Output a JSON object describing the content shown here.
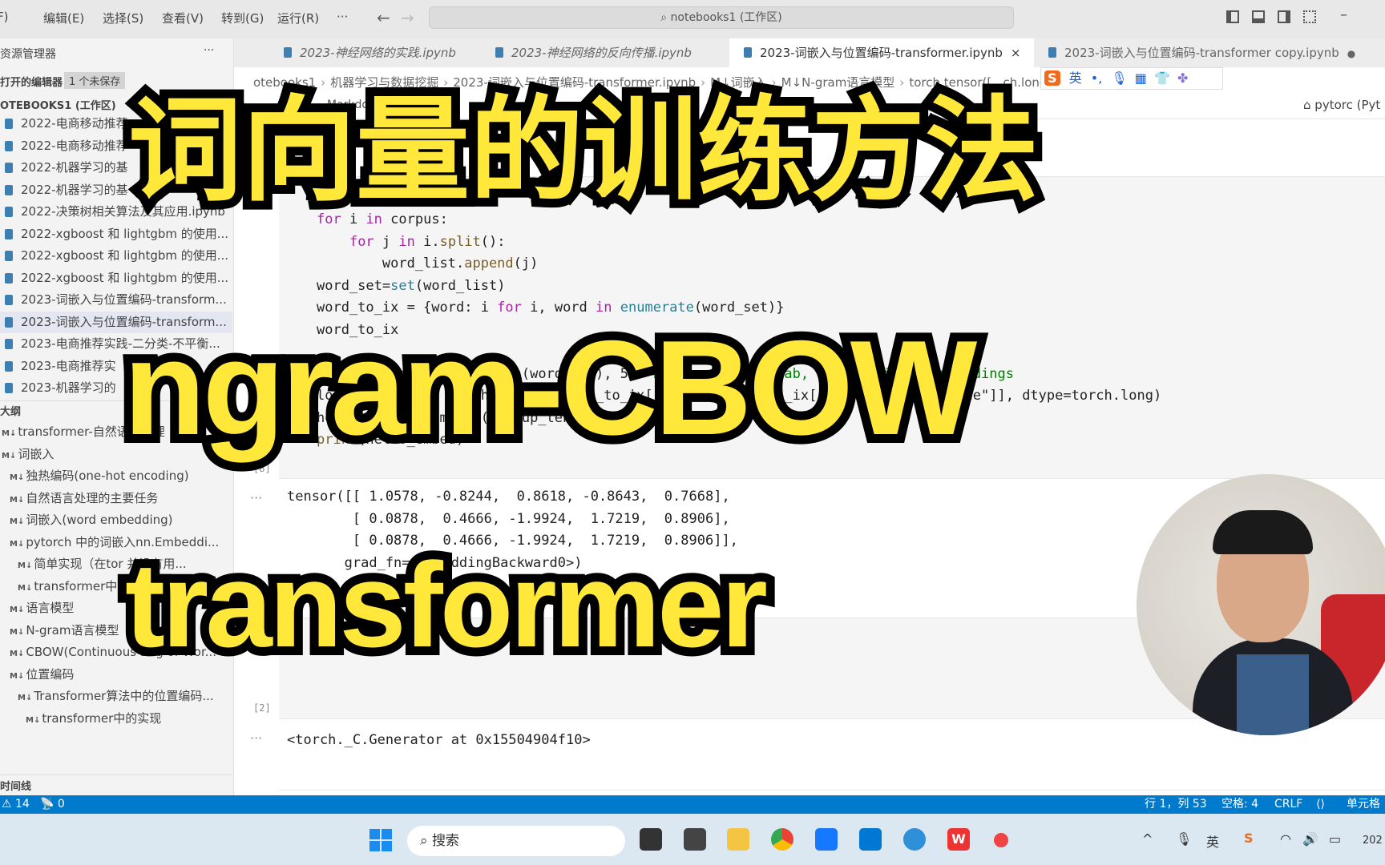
{
  "titlebar": {
    "menus": [
      "F)",
      "编辑(E)",
      "选择(S)",
      "查看(V)",
      "转到(G)",
      "运行(R)",
      "···"
    ],
    "search": "notebooks1 (工作区)"
  },
  "sidebar": {
    "title": "资源管理器",
    "more": "···",
    "open_editors": "打开的编辑器",
    "unsaved_badge": "1 个未保存",
    "workspace": "OTEBOOKS1 (工作区)",
    "files": [
      "2022-电商移动推荐",
      "2022-电商移动推荐",
      "2022-机器学习的基",
      "2022-机器学习的基",
      "2022-决策树相关算法及其应用.ipynb",
      "2022-xgboost 和 lightgbm 的使用...",
      "2022-xgboost 和 lightgbm 的使用...",
      "2022-xgboost 和 lightgbm 的使用...",
      "2023-词嵌入与位置编码-transform...",
      "2023-词嵌入与位置编码-transform...",
      "2023-电商推荐实践-二分类-不平衡...",
      "2023-电商推荐实",
      "2023-机器学习的"
    ],
    "outline_title": "大纲",
    "outline": [
      {
        "label": "transformer-自然语言处理",
        "lvl": 0
      },
      {
        "label": "词嵌入",
        "lvl": 0
      },
      {
        "label": "独热编码(one-hot encoding)",
        "lvl": 1
      },
      {
        "label": "自然语言处理的主要任务",
        "lvl": 1
      },
      {
        "label": "词嵌入(word embedding)",
        "lvl": 1
      },
      {
        "label": "pytorch 中的词嵌入nn.Embeddi...",
        "lvl": 1
      },
      {
        "label": "简单实现（在tor 并没有用...",
        "lvl": 2
      },
      {
        "label": "transformer中的",
        "lvl": 2
      },
      {
        "label": "语言模型",
        "lvl": 1
      },
      {
        "label": "N-gram语言模型",
        "lvl": 1
      },
      {
        "label": "CBOW(Continuous Bag of Wor...",
        "lvl": 1
      },
      {
        "label": "位置编码",
        "lvl": 1
      },
      {
        "label": "Transformer算法中的位置编码...",
        "lvl": 2
      },
      {
        "label": "transformer中的实现",
        "lvl": 3
      }
    ],
    "md_badge": "M↓",
    "timeline": "时间线"
  },
  "tabs": [
    {
      "label": "2023-神经网络的实践.ipynb"
    },
    {
      "label": "2023-神经网络的反向传播.ipynb"
    },
    {
      "label": "2023-词嵌入与位置编码-transformer.ipynb",
      "close": "×"
    },
    {
      "label": "2023-词嵌入与位置编码-transformer copy.ipynb",
      "dot": "●"
    }
  ],
  "breadcrumb": [
    "otebooks1",
    "机器学习与数据挖掘",
    "2023-词嵌入与位置编码-transformer.ipynb",
    "M↓词嵌入",
    "M↓N-gram语言模型",
    "torch.tensor([...ch.long)"
  ],
  "toolbar": {
    "markdown": "Markdown",
    "kernel": "pytorc (Pyt"
  },
  "ime": {
    "lang": "英",
    "punct": "•,"
  },
  "cell1": {
    "exec": "[8]",
    "lines": [
      "for i in corpus:",
      "    for j in i.split():",
      "        word_list.append(j)",
      "word_set=set(word_list)",
      "word_to_ix = {word: i for i, word in enumerate(word_set)}",
      "word_to_ix",
      "",
      "embeds = nn.Embedding(len(word_set), 5)  # 2 words in vocab, 5 dimensional embeddings",
      "lookup_tensor = torch.tensor([word_to_ix[\"hello\"],word_to_ix[\"he\"],word_to_ix[\"he\"]], dtype=torch.long)",
      "hello_embed = embeds(lookup_tensor)",
      "print(hello_embed)"
    ],
    "output": [
      "tensor([[ 1.0578, -0.8244,  0.8618, -0.8643,  0.7668],",
      "        [ 0.0878,  0.4666, -1.9924,  1.7219,  0.8906],",
      "        [ 0.0878,  0.4666, -1.9924,  1.7219,  0.8906]],",
      "       grad_fn=<EmbeddingBackward0>)"
    ]
  },
  "cell2": {
    "exec": "[2]",
    "comment": "# ...t",
    "output": "<torch._C.Generator at 0x15504904f10>"
  },
  "ellipsis": "···",
  "status": {
    "errors": "⚠ 14",
    "ports": "📡 0",
    "position": "行 1，列 53",
    "spaces": "空格: 4",
    "eol": "CRLF",
    "cell": "单元格"
  },
  "taskbar": {
    "search": "搜索",
    "ime": "英",
    "clock": "202"
  },
  "overlay": {
    "title": "词向量的训练方法",
    "line2": "ngram-CBOW",
    "line3": "transformer"
  },
  "colors": {
    "accent": "#007acc",
    "overlay_fill": "#ffe83a",
    "overlay_stroke": "#000000"
  }
}
